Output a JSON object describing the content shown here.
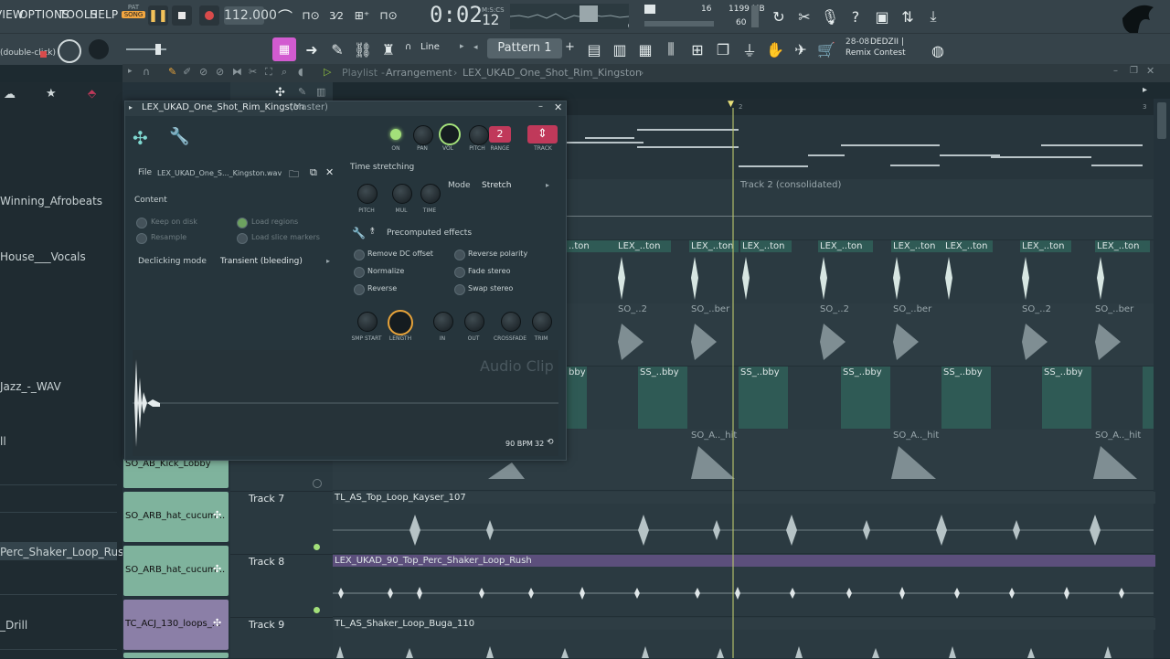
{
  "menu": [
    "VIEW",
    "OPTIONS",
    "TOOLS",
    "HELP"
  ],
  "transport": {
    "pat_label": "PAT",
    "song_label": "SONG",
    "tempo": "112.000",
    "time": "0:02",
    "time_sub": "12",
    "msc_label": "M:S:CS",
    "cpu_voices": "16",
    "memory": "1199 MB",
    "polyphony": "60"
  },
  "bar2": {
    "hint": "(double-click)",
    "snap": "Line",
    "pattern": "Pattern 1",
    "news_date": "28-08",
    "news_user": "DEDZII |",
    "news_title": "Remix Contest"
  },
  "breadcrumb": {
    "part1": "Playlist",
    "sep": "-",
    "part2": "Arrangement",
    "part3": "LEX_UKAD_One_Shot_Rim_Kingston"
  },
  "browser": {
    "items": [
      "Winning_Afrobeats",
      "House___Vocals",
      "Jazz_-_WAV",
      "ll",
      "Perc_Shaker_Loop_Rush",
      "_Drill"
    ]
  },
  "clips": [
    {
      "label": "SO_AB_Kick_Lobby"
    },
    {
      "label": "SO_ARB_hat_cucum..."
    },
    {
      "label": "SO_ARB_hat_cucum..."
    },
    {
      "label": "TC_ACJ_130_loops_..."
    }
  ],
  "tracks": {
    "track7": "Track 7",
    "track8": "Track 8",
    "track9": "Track 9",
    "track2_label": "Track 2 (consolidated)"
  },
  "playlist_clips": {
    "rim": "LEX_..ton",
    "rim_first": "..ton",
    "so": "SO_..2",
    "so_ber": "SO_..ber",
    "ss": "SS_..bby",
    "ss_first": "bby",
    "hit": "SO_A.._hit",
    "t7": "TL_AS_Top_Loop_Kayser_107",
    "t8": "LEX_UKAD_90_Top_Perc_Shaker_Loop_Rush",
    "t9": "TL_AS_Shaker_Loop_Buga_110",
    "ruler_2": "2",
    "ruler_3": "3"
  },
  "plugin": {
    "title": "LEX_UKAD_One_Shot_Rim_Kingston",
    "title_suffix": "(Master)",
    "knobs_top": {
      "on": "ON",
      "pan": "PAN",
      "vol": "VOL",
      "pitch": "PITCH",
      "range": "RANGE",
      "track": "TRACK",
      "range_value": "2"
    },
    "file_label": "File",
    "file_name": "LEX_UKAD_One_S..._Kingston.wav",
    "content_label": "Content",
    "keep_on_disk": "Keep on disk",
    "load_regions": "Load regions",
    "resample": "Resample",
    "load_slice_markers": "Load slice markers",
    "declicking_label": "Declicking mode",
    "declicking_value": "Transient (bleeding)",
    "time_stretching": "Time stretching",
    "ts_pitch": "PITCH",
    "ts_mul": "MUL",
    "ts_time": "TIME",
    "mode_label": "Mode",
    "mode_value": "Stretch",
    "precomputed": "Precomputed effects",
    "fx": [
      "Remove DC offset",
      "Reverse polarity",
      "Normalize",
      "Fade stereo",
      "Reverse",
      "Swap stereo"
    ],
    "bottom_knobs": [
      "SMP START",
      "LENGTH",
      "IN",
      "OUT",
      "CROSSFADE",
      "TRIM"
    ],
    "watermark": "Audio Clip",
    "bpm": "90 BPM",
    "bpm_value": "32"
  },
  "colors": {
    "accent_green": "#a3e07a",
    "clip_teal": "#2f5a55",
    "clip_purple": "#5c4f7c",
    "record_red": "#d84b4b",
    "track_magenta": "#c0395a",
    "length_orange": "#e7a33a"
  }
}
